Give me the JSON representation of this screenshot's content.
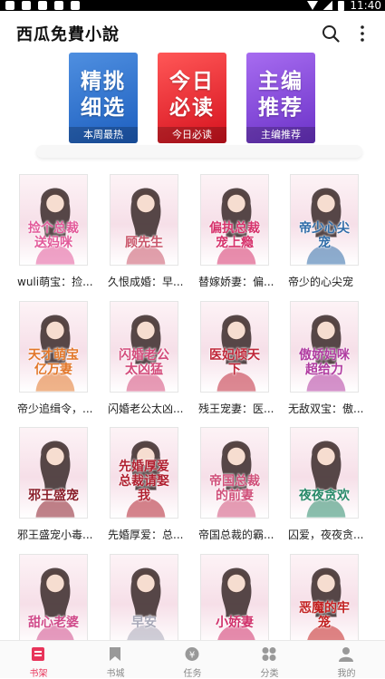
{
  "status_bar": {
    "time": "11:40"
  },
  "header": {
    "title": "西瓜免費小說"
  },
  "banners": [
    {
      "big": "精挑细选",
      "caption": "本周最热",
      "color": "#2a6cc8"
    },
    {
      "big": "今日必读",
      "caption": "今日必读",
      "color": "#e01f2a"
    },
    {
      "big": "主编推荐",
      "caption": "主编推荐",
      "color": "#7a3cd6"
    }
  ],
  "books": [
    {
      "label": "wuli萌宝：捡...",
      "cover_text": "捡个总裁送妈咪",
      "cover_color": "#e25a9a"
    },
    {
      "label": "久恨成婚：早...",
      "cover_text": "顾先生",
      "cover_color": "#c9556a"
    },
    {
      "label": "替嫁娇妻：偏...",
      "cover_text": "偏执总裁宠上瘾",
      "cover_color": "#d6336c"
    },
    {
      "label": "帝少的心尖宠",
      "cover_text": "帝少心尖宠",
      "cover_color": "#2f6ca8"
    },
    {
      "label": "帝少追缉令，...",
      "cover_text": "天才萌宝亿万妻",
      "cover_color": "#e2772a"
    },
    {
      "label": "闪婚老公太凶...",
      "cover_text": "闪婚老公太凶猛",
      "cover_color": "#d34a7a"
    },
    {
      "label": "残王宠妻：医...",
      "cover_text": "医妃倾天下",
      "cover_color": "#c0283a"
    },
    {
      "label": "无敌双宝：傲...",
      "cover_text": "傲娇妈咪超给力",
      "cover_color": "#b03aa0"
    },
    {
      "label": "邪王盛宠小毒...",
      "cover_text": "邪王盛宠",
      "cover_color": "#8a1e2a"
    },
    {
      "label": "先婚厚爱：总...",
      "cover_text": "先婚厚爱总裁请娶我",
      "cover_color": "#b02030"
    },
    {
      "label": "帝国总裁的霸...",
      "cover_text": "帝国总裁的前妻",
      "cover_color": "#d0507a"
    },
    {
      "label": "囚爱，夜夜贪...",
      "cover_text": "夜夜贪欢",
      "cover_color": "#2a8a6a"
    },
    {
      "label": "",
      "cover_text": "甜心老婆",
      "cover_color": "#d04a8a"
    },
    {
      "label": "",
      "cover_text": "早安",
      "cover_color": "#a8a8b8"
    },
    {
      "label": "",
      "cover_text": "小娇妻",
      "cover_color": "#d0306a"
    },
    {
      "label": "",
      "cover_text": "恶魔的牢笼",
      "cover_color": "#c22020"
    }
  ],
  "tabs": [
    {
      "label": "书架",
      "icon": "bookshelf-icon",
      "active": true
    },
    {
      "label": "书城",
      "icon": "bookmark-icon",
      "active": false
    },
    {
      "label": "任务",
      "icon": "coin-icon",
      "active": false
    },
    {
      "label": "分类",
      "icon": "grid-icon",
      "active": false
    },
    {
      "label": "我的",
      "icon": "profile-icon",
      "active": false
    }
  ]
}
